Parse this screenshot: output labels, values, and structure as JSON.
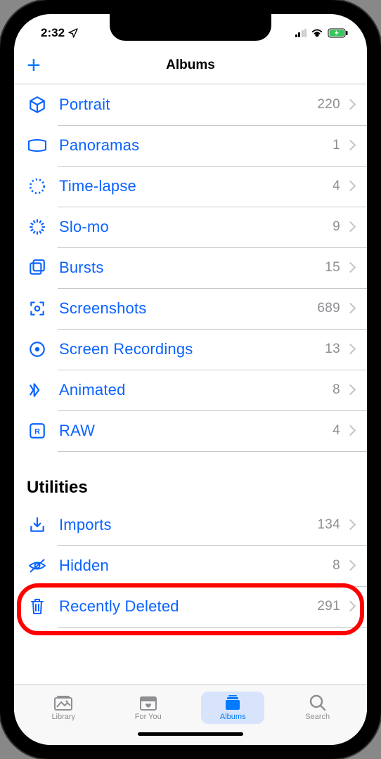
{
  "status": {
    "time": "2:32",
    "location_icon": "✈"
  },
  "nav": {
    "title": "Albums",
    "add": "+"
  },
  "media_types": [
    {
      "icon": "cube",
      "label": "Portrait",
      "count": "220"
    },
    {
      "icon": "pano",
      "label": "Panoramas",
      "count": "1"
    },
    {
      "icon": "timelapse",
      "label": "Time-lapse",
      "count": "4"
    },
    {
      "icon": "slomo",
      "label": "Slo-mo",
      "count": "9"
    },
    {
      "icon": "bursts",
      "label": "Bursts",
      "count": "15"
    },
    {
      "icon": "screenshots",
      "label": "Screenshots",
      "count": "689"
    },
    {
      "icon": "screenrec",
      "label": "Screen Recordings",
      "count": "13"
    },
    {
      "icon": "animated",
      "label": "Animated",
      "count": "8"
    },
    {
      "icon": "raw",
      "label": "RAW",
      "count": "4"
    }
  ],
  "utilities_header": "Utilities",
  "utilities": [
    {
      "icon": "imports",
      "label": "Imports",
      "count": "134"
    },
    {
      "icon": "hidden",
      "label": "Hidden",
      "count": "8"
    },
    {
      "icon": "trash",
      "label": "Recently Deleted",
      "count": "291",
      "highlighted": true
    }
  ],
  "tabs": [
    {
      "icon": "library",
      "label": "Library",
      "active": false
    },
    {
      "icon": "foryou",
      "label": "For You",
      "active": false
    },
    {
      "icon": "albums",
      "label": "Albums",
      "active": true
    },
    {
      "icon": "search",
      "label": "Search",
      "active": false
    }
  ]
}
